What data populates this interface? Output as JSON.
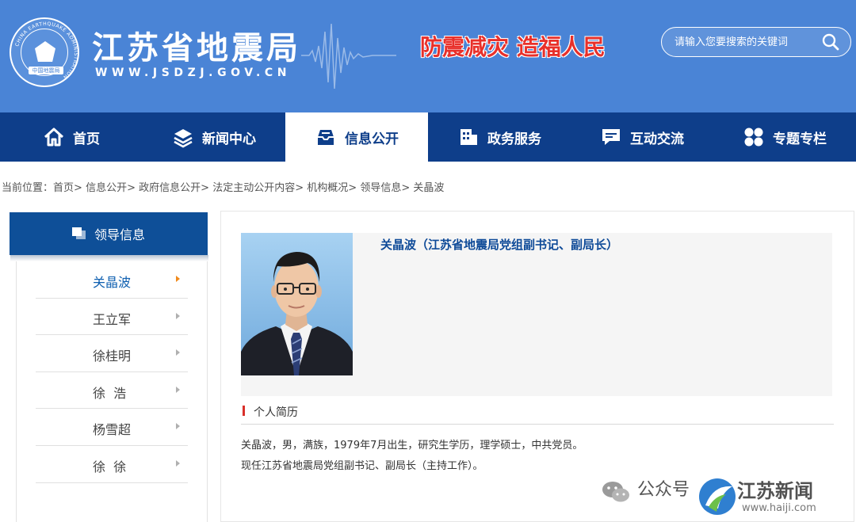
{
  "header": {
    "site_title": "江苏省地震局",
    "site_url": "WWW.JSDZJ.GOV.CN",
    "slogan": "防震减灾  造福人民",
    "search_placeholder": "请输入您要搜索的关键词",
    "logo_ring_text": "CHINA EARTHQUAKE ADMINISTRATION",
    "logo_base_text": "中国地震局",
    "colors": {
      "banner": "#4a84d6",
      "slogan": "#e8302a"
    }
  },
  "nav": {
    "items": [
      {
        "label": "首页",
        "icon": "home-icon"
      },
      {
        "label": "新闻中心",
        "icon": "layers-icon"
      },
      {
        "label": "信息公开",
        "icon": "inbox-icon"
      },
      {
        "label": "政务服务",
        "icon": "building-icon"
      },
      {
        "label": "互动交流",
        "icon": "chat-icon"
      },
      {
        "label": "专题专栏",
        "icon": "grid-icon"
      }
    ],
    "active_index": 2,
    "colors": {
      "background": "#0e3e8a",
      "active_background": "#ffffff"
    }
  },
  "breadcrumb": {
    "prefix": "当前位置：",
    "items": [
      "首页",
      "信息公开",
      "政府信息公开",
      "法定主动公开内容",
      "机构概况",
      "领导信息",
      "关晶波"
    ],
    "separator": ">"
  },
  "sidebar": {
    "title": "领导信息",
    "items": [
      "关晶波",
      "王立军",
      "徐桂明",
      "徐  浩",
      "杨雪超",
      "徐  徐"
    ],
    "active_index": 0
  },
  "profile": {
    "title": "关晶波（江苏省地震局党组副书记、副局长）",
    "section_title": "个人简历",
    "bio_lines": [
      "关晶波，男，满族，1979年7月出生，研究生学历，理学硕士，中共党员。",
      "现任江苏省地震局党组副书记、副局长（主持工作）。"
    ]
  },
  "watermark": {
    "gzh_label": "公众号",
    "brand": "江苏新闻",
    "domain": "www.haiji.com"
  }
}
